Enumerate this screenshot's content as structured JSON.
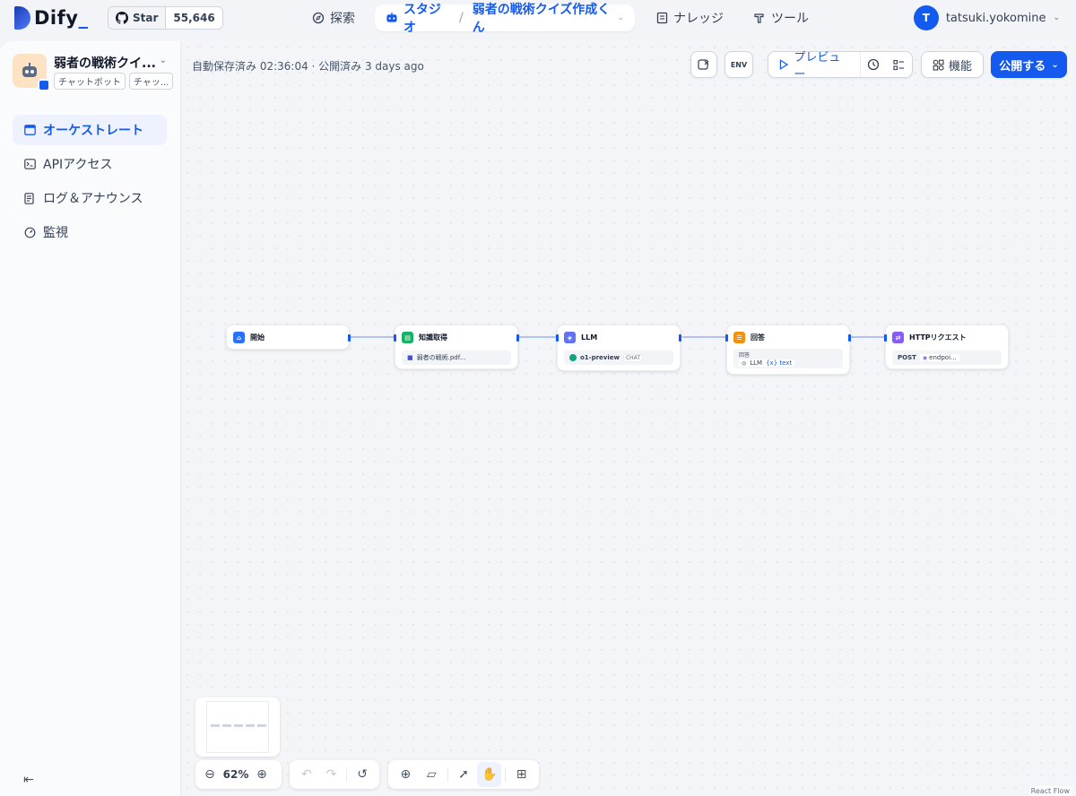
{
  "topbar": {
    "logo_text": "Dify",
    "github": {
      "label": "Star",
      "count": "55,646"
    },
    "nav": {
      "explore": "探索",
      "studio": "スタジオ",
      "app_name": "弱者の戦術クイズ作成くん",
      "knowledge": "ナレッジ",
      "tools": "ツール"
    },
    "user": {
      "initial": "T",
      "name": "tatsuki.yokomine"
    }
  },
  "sidebar": {
    "app_title": "弱者の戦術クイ...",
    "tags": [
      "チャットボット",
      "チャッ..."
    ],
    "items": [
      {
        "label": "オーケストレート",
        "icon": "window-icon",
        "active": true
      },
      {
        "label": "APIアクセス",
        "icon": "terminal-icon",
        "active": false
      },
      {
        "label": "ログ＆アナウンス",
        "icon": "file-list-icon",
        "active": false
      },
      {
        "label": "監視",
        "icon": "gauge-icon",
        "active": false
      }
    ]
  },
  "canvas": {
    "save_status": "自動保存済み 02:36:04 · 公開済み 3 days ago",
    "toolbar": {
      "env_label": "ENV",
      "preview": "プレビュー",
      "features": "機能",
      "publish": "公開する"
    },
    "nodes": {
      "start": {
        "title": "開始"
      },
      "knowledge": {
        "title": "知識取得",
        "dataset": "弱者の戦術.pdf..."
      },
      "llm": {
        "title": "LLM",
        "model": "o1-preview",
        "mode": "CHAT"
      },
      "answer": {
        "title": "回答",
        "label": "回答",
        "ref_node": "LLM",
        "ref_var": "{x} text"
      },
      "http": {
        "title": "HTTPリクエスト",
        "method": "POST",
        "url": "endpoi..."
      }
    },
    "zoom": "62%",
    "attribution": "React Flow"
  },
  "colors": {
    "accent": "#155aef",
    "start": "#2970ff",
    "knowledge": "#16b364",
    "llm": "#6172f3",
    "answer": "#f79009",
    "http": "#875bf7"
  }
}
